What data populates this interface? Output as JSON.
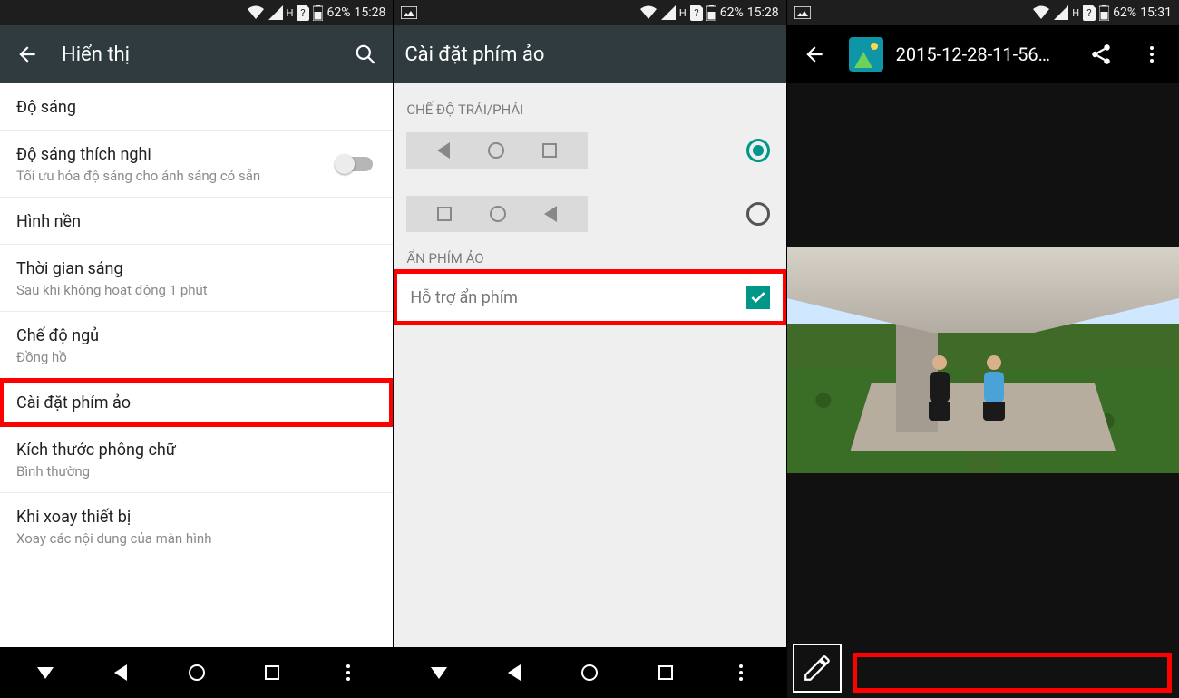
{
  "status": {
    "battery": "62%",
    "time1": "15:28",
    "time3": "15:31",
    "net_badge": "H"
  },
  "panel1": {
    "title": "Hiển thị",
    "items": [
      {
        "primary": "Độ sáng"
      },
      {
        "primary": "Độ sáng thích nghi",
        "secondary": "Tối ưu hóa độ sáng cho ánh sáng có sẵn",
        "switch": false
      },
      {
        "primary": "Hình nền"
      },
      {
        "primary": "Thời gian sáng",
        "secondary": "Sau khi không hoạt động 1 phút"
      },
      {
        "primary": "Chế độ ngủ",
        "secondary": "Đồng hồ"
      },
      {
        "primary": "Cài đặt phím ảo",
        "highlight": true
      },
      {
        "primary": "Kích thước phông chữ",
        "secondary": "Bình thường"
      },
      {
        "primary": "Khi xoay thiết bị",
        "secondary": "Xoay các nội dung của màn hình"
      }
    ]
  },
  "panel2": {
    "title": "Cài đặt phím ảo",
    "section_lr": "CHẾ ĐỘ TRÁI/PHẢI",
    "section_hide": "ẨN PHÍM ẢO",
    "hide_support": "Hỗ trợ ẩn phím",
    "choice": "left",
    "hide_checked": true
  },
  "panel3": {
    "title": "2015-12-28-11-56…"
  }
}
